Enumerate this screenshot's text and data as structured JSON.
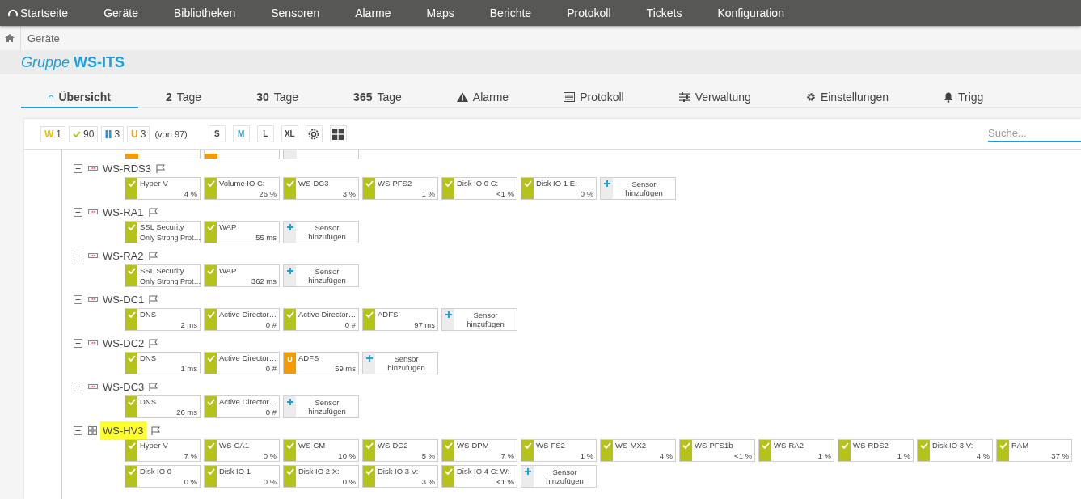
{
  "nav": {
    "items": [
      {
        "label": "Startseite",
        "kind": "home"
      },
      {
        "label": "Geräte"
      },
      {
        "label": "Bibliotheken"
      },
      {
        "label": "Sensoren"
      },
      {
        "label": "Alarme"
      },
      {
        "label": "Maps"
      },
      {
        "label": "Berichte"
      },
      {
        "label": "Protokoll"
      },
      {
        "label": "Tickets"
      },
      {
        "label": "Konfiguration"
      }
    ]
  },
  "breadcrumb": [
    "Geräte"
  ],
  "heading": {
    "prefix": "Gruppe",
    "name": "WS-ITS"
  },
  "tabs": [
    {
      "kind": "overview",
      "label": "Übersicht",
      "selected": true
    },
    {
      "number": "2",
      "label": "Tage",
      "selected": false
    },
    {
      "number": "30",
      "label": "Tage",
      "selected": false
    },
    {
      "number": "365",
      "label": "Tage",
      "selected": false
    },
    {
      "kind": "alarms",
      "label": "Alarme",
      "selected": false
    },
    {
      "kind": "log",
      "label": "Protokoll",
      "selected": false
    },
    {
      "kind": "management",
      "label": "Verwaltung",
      "selected": false
    },
    {
      "kind": "settings",
      "label": "Einstellungen",
      "selected": false
    },
    {
      "kind": "triggers",
      "label": "Trigg",
      "selected": false
    }
  ],
  "status_counts": [
    {
      "kind": "warning",
      "symbol": "W",
      "count": "1"
    },
    {
      "kind": "up",
      "count": "90"
    },
    {
      "kind": "paused",
      "count": "3"
    },
    {
      "kind": "unusual",
      "symbol": "U",
      "count": "3"
    }
  ],
  "total": "(von 97)",
  "sizes": [
    {
      "label": "S",
      "selected": false
    },
    {
      "label": "M",
      "selected": true
    },
    {
      "label": "L",
      "selected": false
    },
    {
      "label": "XL",
      "selected": false
    }
  ],
  "search": {
    "placeholder": "Suche..."
  },
  "partial_tiles": [
    {
      "kind": "sensor",
      "color": "#f59a00"
    },
    {
      "kind": "sensor",
      "color": "#f59a00"
    },
    {
      "kind": "add"
    }
  ],
  "devices": [
    {
      "name": "WS-RDS3",
      "kind": "server",
      "expanded": true,
      "highlighted": false,
      "tiles": [
        {
          "kind": "sensor",
          "color": "#b5c21a",
          "name": "Hyper-V",
          "value": "4 %"
        },
        {
          "kind": "sensor",
          "color": "#b5c21a",
          "name": "Volume IO C:",
          "value": "26 %"
        },
        {
          "kind": "sensor",
          "color": "#b5c21a",
          "name": "WS-DC3",
          "value": "3 %"
        },
        {
          "kind": "sensor",
          "color": "#b5c21a",
          "name": "WS-PFS2",
          "value": "1 %"
        },
        {
          "kind": "sensor",
          "color": "#b5c21a",
          "name": "Disk IO 0 C:",
          "value": "<1 %"
        },
        {
          "kind": "sensor",
          "color": "#b5c21a",
          "name": "Disk IO 1 E:",
          "value": "0 %"
        },
        {
          "kind": "add",
          "label": "Sensor hinzufügen"
        }
      ]
    },
    {
      "name": "WS-RA1",
      "kind": "server",
      "expanded": true,
      "highlighted": false,
      "tiles": [
        {
          "kind": "sensor",
          "color": "#b5c21a",
          "name": "SSL Security",
          "detail": "Only Strong Prot…"
        },
        {
          "kind": "sensor",
          "color": "#b5c21a",
          "name": "WAP",
          "value": "55 ms"
        },
        {
          "kind": "add",
          "label": "Sensor hinzufügen"
        }
      ]
    },
    {
      "name": "WS-RA2",
      "kind": "server",
      "expanded": true,
      "highlighted": false,
      "tiles": [
        {
          "kind": "sensor",
          "color": "#b5c21a",
          "name": "SSL Security",
          "detail": "Only Strong Prot…"
        },
        {
          "kind": "sensor",
          "color": "#b5c21a",
          "name": "WAP",
          "value": "362 ms"
        },
        {
          "kind": "add",
          "label": "Sensor hinzufügen"
        }
      ]
    },
    {
      "name": "WS-DC1",
      "kind": "server",
      "expanded": true,
      "highlighted": false,
      "tiles": [
        {
          "kind": "sensor",
          "color": "#b5c21a",
          "name": "DNS",
          "value": "2 ms"
        },
        {
          "kind": "sensor",
          "color": "#b5c21a",
          "name": "Active Director…",
          "value": "0 #"
        },
        {
          "kind": "sensor",
          "color": "#b5c21a",
          "name": "Active Director…",
          "value": "0 #"
        },
        {
          "kind": "sensor",
          "color": "#b5c21a",
          "name": "ADFS",
          "value": "97 ms"
        },
        {
          "kind": "add",
          "label": "Sensor hinzufügen"
        }
      ]
    },
    {
      "name": "WS-DC2",
      "kind": "server",
      "expanded": true,
      "highlighted": false,
      "tiles": [
        {
          "kind": "sensor",
          "color": "#b5c21a",
          "name": "DNS",
          "value": "1 ms"
        },
        {
          "kind": "sensor",
          "color": "#b5c21a",
          "name": "Active Director…",
          "value": "0 #"
        },
        {
          "kind": "sensor",
          "color": "#f59a00",
          "badge": "U",
          "name": "ADFS",
          "value": "59 ms"
        },
        {
          "kind": "add",
          "label": "Sensor hinzufügen"
        }
      ]
    },
    {
      "name": "WS-DC3",
      "kind": "server",
      "expanded": true,
      "highlighted": false,
      "tiles": [
        {
          "kind": "sensor",
          "color": "#b5c21a",
          "name": "DNS",
          "value": "26 ms"
        },
        {
          "kind": "sensor",
          "color": "#b5c21a",
          "name": "Active Director…",
          "value": "0 #"
        },
        {
          "kind": "add",
          "label": "Sensor hinzufügen"
        }
      ]
    },
    {
      "name": "WS-HV3",
      "kind": "hyperv",
      "expanded": true,
      "highlighted": true,
      "tiles": [
        {
          "kind": "sensor",
          "color": "#b5c21a",
          "name": "Hyper-V",
          "value": "7 %"
        },
        {
          "kind": "sensor",
          "color": "#b5c21a",
          "name": "WS-CA1",
          "value": "0 %"
        },
        {
          "kind": "sensor",
          "color": "#b5c21a",
          "name": "WS-CM",
          "value": "10 %"
        },
        {
          "kind": "sensor",
          "color": "#b5c21a",
          "name": "WS-DC2",
          "value": "5 %"
        },
        {
          "kind": "sensor",
          "color": "#b5c21a",
          "name": "WS-DPM",
          "value": "7 %"
        },
        {
          "kind": "sensor",
          "color": "#b5c21a",
          "name": "WS-FS2",
          "value": "1 %"
        },
        {
          "kind": "sensor",
          "color": "#b5c21a",
          "name": "WS-MX2",
          "value": "4 %"
        },
        {
          "kind": "sensor",
          "color": "#b5c21a",
          "name": "WS-PFS1b",
          "value": "<1 %"
        },
        {
          "kind": "sensor",
          "color": "#b5c21a",
          "name": "WS-RA2",
          "value": "1 %"
        },
        {
          "kind": "sensor",
          "color": "#b5c21a",
          "name": "WS-RDS2",
          "value": "1 %"
        },
        {
          "kind": "sensor",
          "color": "#b5c21a",
          "name": "Disk IO 3 V:",
          "value": "4 %"
        },
        {
          "kind": "sensor",
          "color": "#b5c21a",
          "name": "RAM",
          "value": "37 %"
        },
        {
          "kind": "sensor",
          "color": "#b5c21a",
          "name": "Disk IO 0",
          "value": "0 %"
        },
        {
          "kind": "sensor",
          "color": "#b5c21a",
          "name": "Disk IO 1",
          "value": "0 %"
        },
        {
          "kind": "sensor",
          "color": "#b5c21a",
          "name": "Disk IO 2 X:",
          "value": "0 %"
        },
        {
          "kind": "sensor",
          "color": "#b5c21a",
          "name": "Disk IO 3 V:",
          "value": "3 %"
        },
        {
          "kind": "sensor",
          "color": "#b5c21a",
          "name": "Disk IO 4 C: W:",
          "value": "<1 %"
        },
        {
          "kind": "add",
          "label": "Sensor hinzufügen"
        }
      ]
    }
  ]
}
